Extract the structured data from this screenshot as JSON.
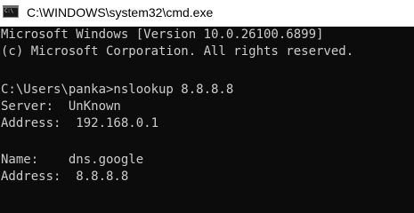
{
  "window": {
    "title": "C:\\WINDOWS\\system32\\cmd.exe",
    "icon": "cmd-icon",
    "icon_glyph": "C:\\",
    "colors": {
      "titlebar_bg": "#ffffff",
      "console_bg": "#0c0c0c",
      "console_text": "#cccccc"
    }
  },
  "console": {
    "lines": [
      "Microsoft Windows [Version 10.0.26100.6899]",
      "(c) Microsoft Corporation. All rights reserved.",
      "",
      "C:\\Users\\panka>nslookup 8.8.8.8",
      "Server:  UnKnown",
      "Address:  192.168.0.1",
      "",
      "Name:    dns.google",
      "Address:  8.8.8.8"
    ]
  }
}
